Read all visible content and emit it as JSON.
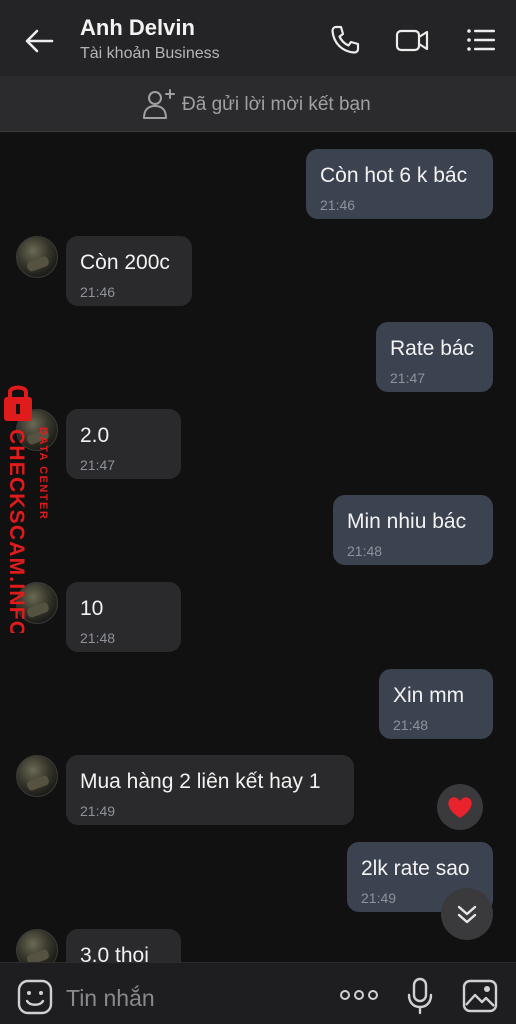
{
  "header": {
    "name": "Anh Delvin",
    "account_type": "Tài khoản Business"
  },
  "friend_bar": {
    "text": "Đã gửi lời mời kết bạn"
  },
  "messages": [
    {
      "direction": "out",
      "text": "Còn hot 6 k bác",
      "time": "21:46"
    },
    {
      "direction": "in",
      "text": "Còn 200c",
      "time": "21:46"
    },
    {
      "direction": "out",
      "text": "Rate bác",
      "time": "21:47"
    },
    {
      "direction": "in",
      "text": "2.0",
      "time": "21:47"
    },
    {
      "direction": "out",
      "text": "Min nhiu bác",
      "time": "21:48"
    },
    {
      "direction": "in",
      "text": "10",
      "time": "21:48"
    },
    {
      "direction": "out",
      "text": "Xin mm",
      "time": "21:48"
    },
    {
      "direction": "in",
      "text": "Mua hàng 2 liên kết hay 1",
      "time": "21:49"
    },
    {
      "direction": "out",
      "text": "2lk rate sao",
      "time": "21:49"
    },
    {
      "direction": "in",
      "text": "3.0 thoi",
      "time": ""
    }
  ],
  "watermark": {
    "line1": "DATA CENTER",
    "line2": "CHECKSCAM.INFO"
  },
  "composer": {
    "placeholder": "Tin nhắn"
  },
  "colors": {
    "outgoing_bubble": "#3c4350",
    "incoming_bubble": "#2a2a2c",
    "background": "#111112",
    "heart": "#e8232b",
    "watermark": "#e01b1b"
  }
}
